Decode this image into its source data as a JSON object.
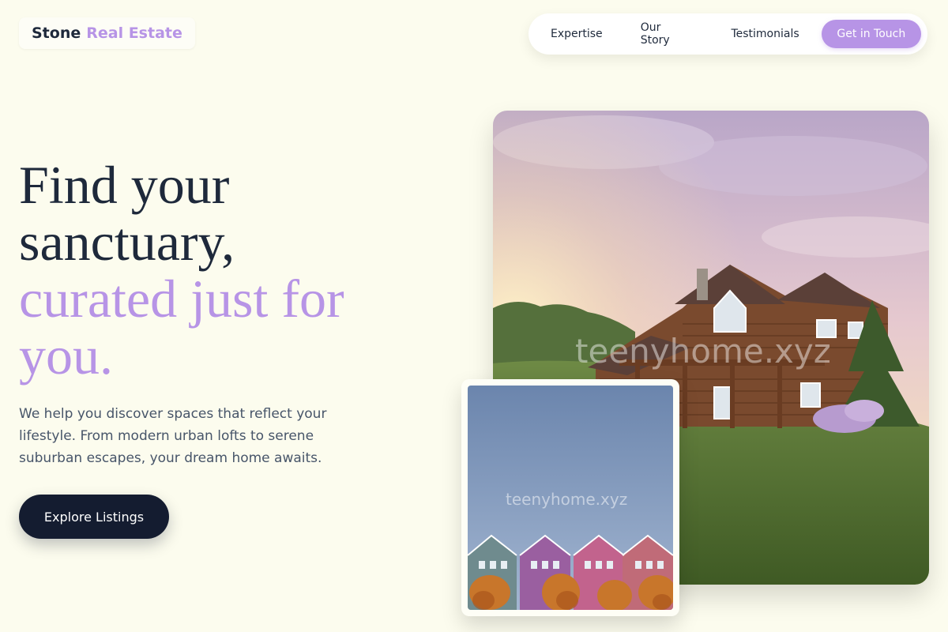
{
  "brand": {
    "name_part1": "Stone",
    "name_part2": "Real Estate",
    "accent_color": "#b794e6"
  },
  "nav": {
    "items": [
      {
        "label": "Expertise"
      },
      {
        "label": "Our Story"
      },
      {
        "label": "Testimonials"
      }
    ],
    "cta_label": "Get in Touch"
  },
  "hero": {
    "title_line1": "Find your",
    "title_line2": "sanctuary,",
    "title_accent_line1": "curated just for",
    "title_accent_line2": "you.",
    "description": "We help you discover spaces that reflect your lifestyle. From modern urban lofts to serene suburban escapes, your dream home awaits.",
    "cta_label": "Explore Listings"
  },
  "images": {
    "main": {
      "subject": "log-cabin-house",
      "watermark": "teenyhome.xyz"
    },
    "secondary": {
      "subject": "colorful-row-houses",
      "watermark": "teenyhome.xyz"
    }
  },
  "colors": {
    "background": "#fcfcee",
    "text_dark": "#1e293b",
    "cta_dark": "#141c30"
  }
}
